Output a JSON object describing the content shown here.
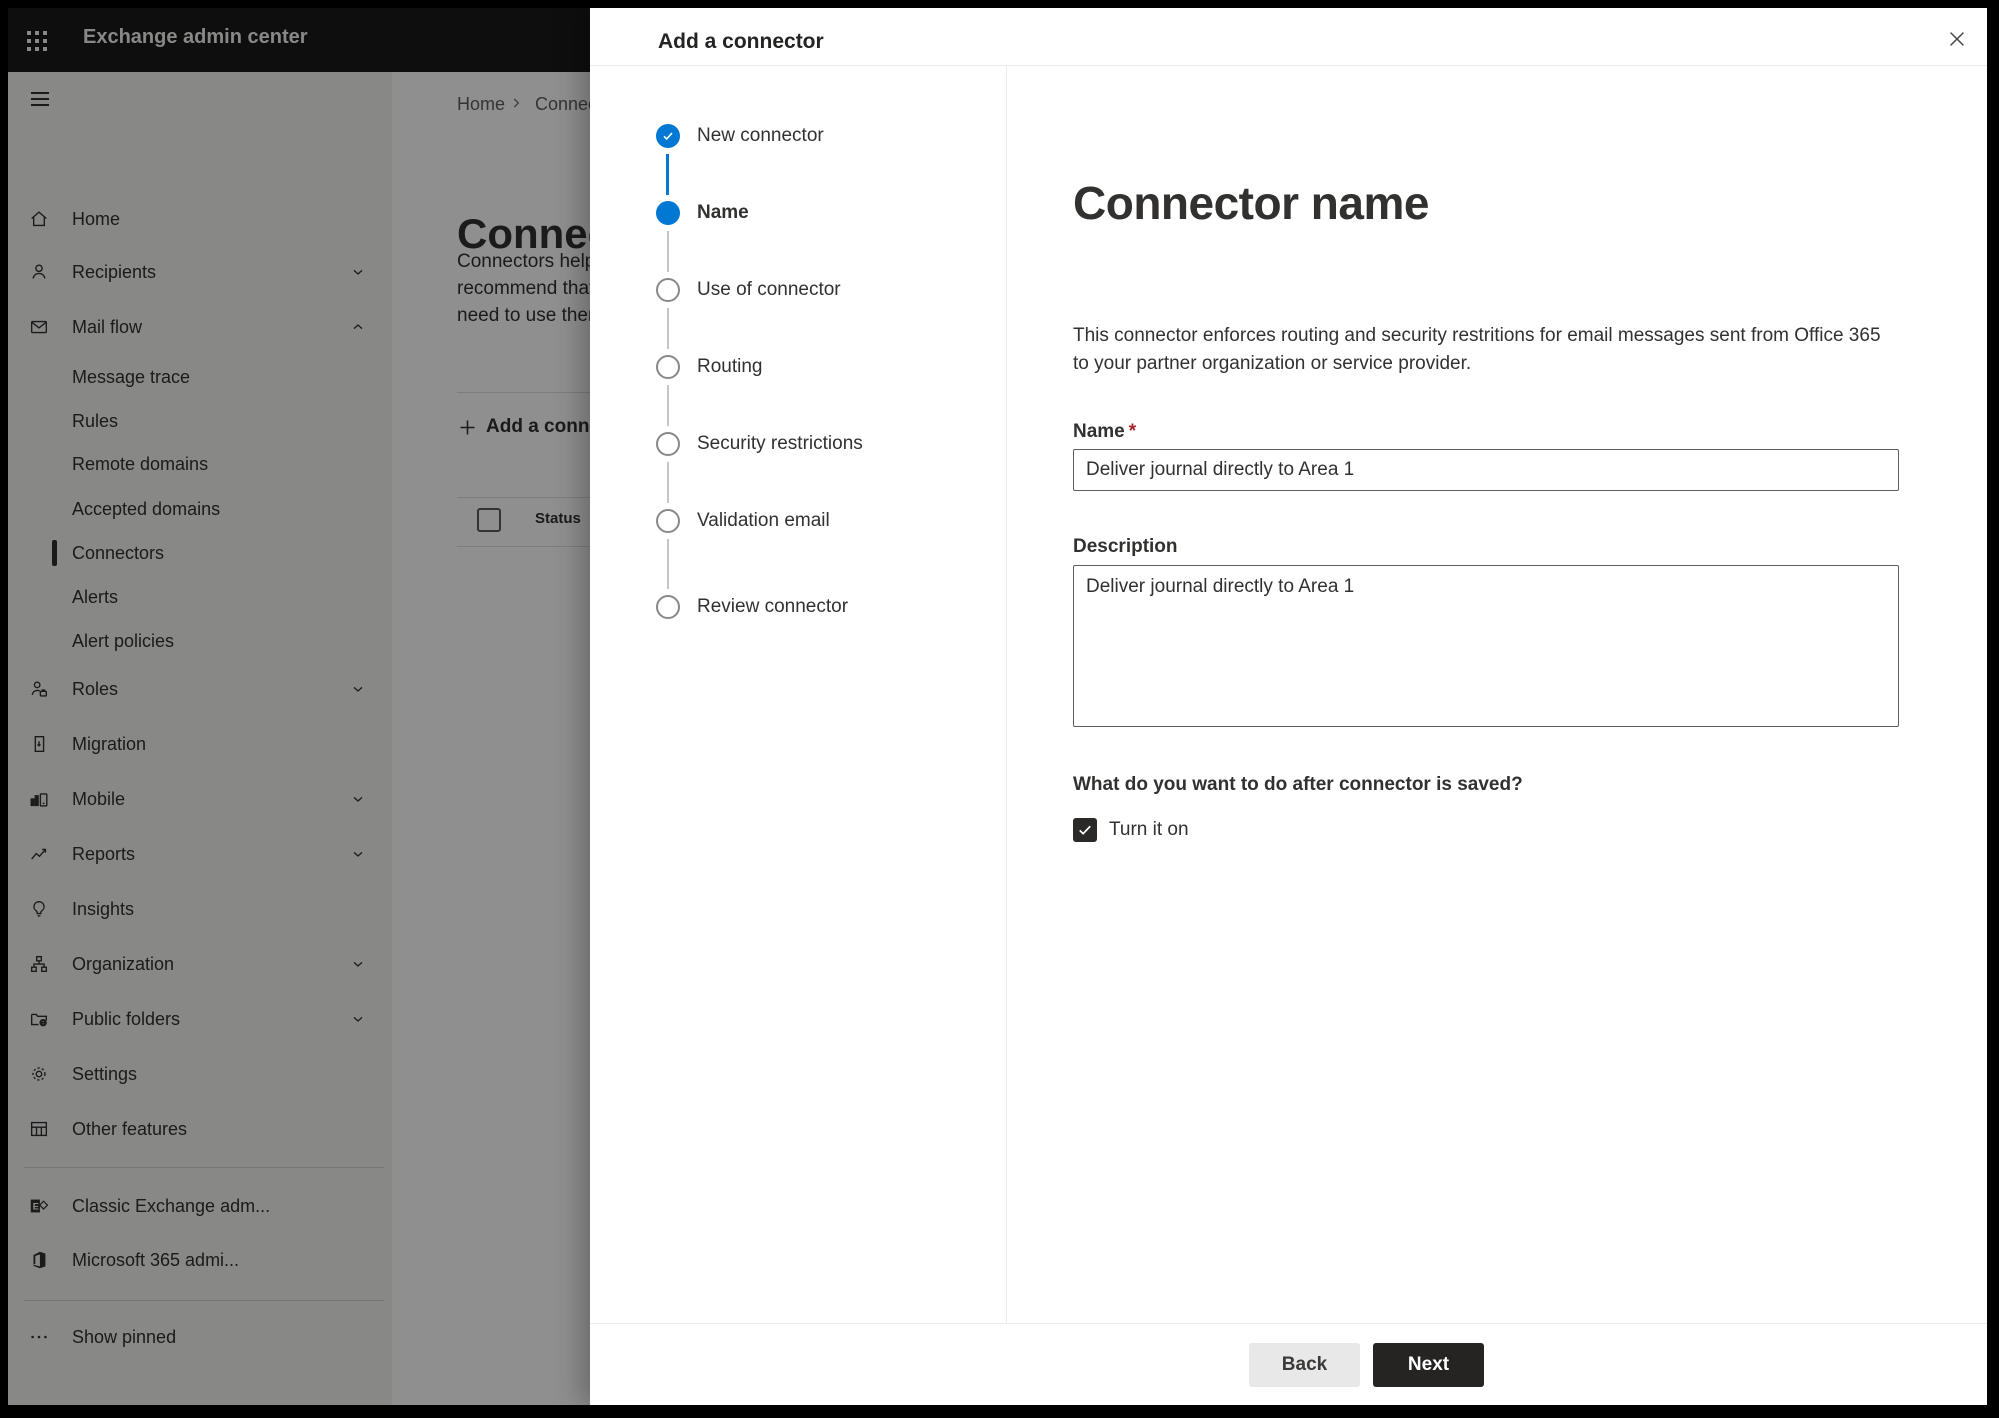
{
  "topbar": {
    "app_title": "Exchange admin center"
  },
  "sidebar": {
    "items": [
      {
        "label": "Home"
      },
      {
        "label": "Recipients"
      },
      {
        "label": "Mail flow"
      },
      {
        "label": "Message trace"
      },
      {
        "label": "Rules"
      },
      {
        "label": "Remote domains"
      },
      {
        "label": "Accepted domains"
      },
      {
        "label": "Connectors"
      },
      {
        "label": "Alerts"
      },
      {
        "label": "Alert policies"
      },
      {
        "label": "Roles"
      },
      {
        "label": "Migration"
      },
      {
        "label": "Mobile"
      },
      {
        "label": "Reports"
      },
      {
        "label": "Insights"
      },
      {
        "label": "Organization"
      },
      {
        "label": "Public folders"
      },
      {
        "label": "Settings"
      },
      {
        "label": "Other features"
      },
      {
        "label": "Classic Exchange adm..."
      },
      {
        "label": "Microsoft 365 admi..."
      },
      {
        "label": "Show pinned"
      }
    ]
  },
  "page": {
    "breadcrumb": {
      "home": "Home",
      "current": "Connectors"
    },
    "title": "Connectors",
    "description_lines": [
      "Connectors help",
      "recommend that",
      "need to use ther"
    ],
    "add_button": "Add a connector",
    "table": {
      "status_header": "Status"
    }
  },
  "dialog": {
    "title": "Add a connector",
    "steps": [
      {
        "label": "New connector",
        "state": "completed"
      },
      {
        "label": "Name",
        "state": "current"
      },
      {
        "label": "Use of connector",
        "state": "upcoming"
      },
      {
        "label": "Routing",
        "state": "upcoming"
      },
      {
        "label": "Security restrictions",
        "state": "upcoming"
      },
      {
        "label": "Validation email",
        "state": "upcoming"
      },
      {
        "label": "Review connector",
        "state": "upcoming"
      }
    ],
    "content": {
      "heading": "Connector name",
      "description_lines": [
        "This connector enforces routing and security restritions for email messages sent from Office 365",
        "to your partner organization or service provider."
      ],
      "name_label": "Name",
      "required_mark": "*",
      "name_value": "Deliver journal directly to Area 1",
      "description_label": "Description",
      "description_value": "Deliver journal directly to Area 1",
      "after_save_question": "What do you want to do after connector is saved?",
      "turn_on_label": "Turn it on",
      "turn_on_checked": true
    },
    "footer": {
      "back": "Back",
      "next": "Next"
    }
  },
  "colors": {
    "accent": "#0078d4",
    "header_bg": "#1b1a19",
    "required": "#a4262c",
    "selected_bar": "#323130"
  }
}
